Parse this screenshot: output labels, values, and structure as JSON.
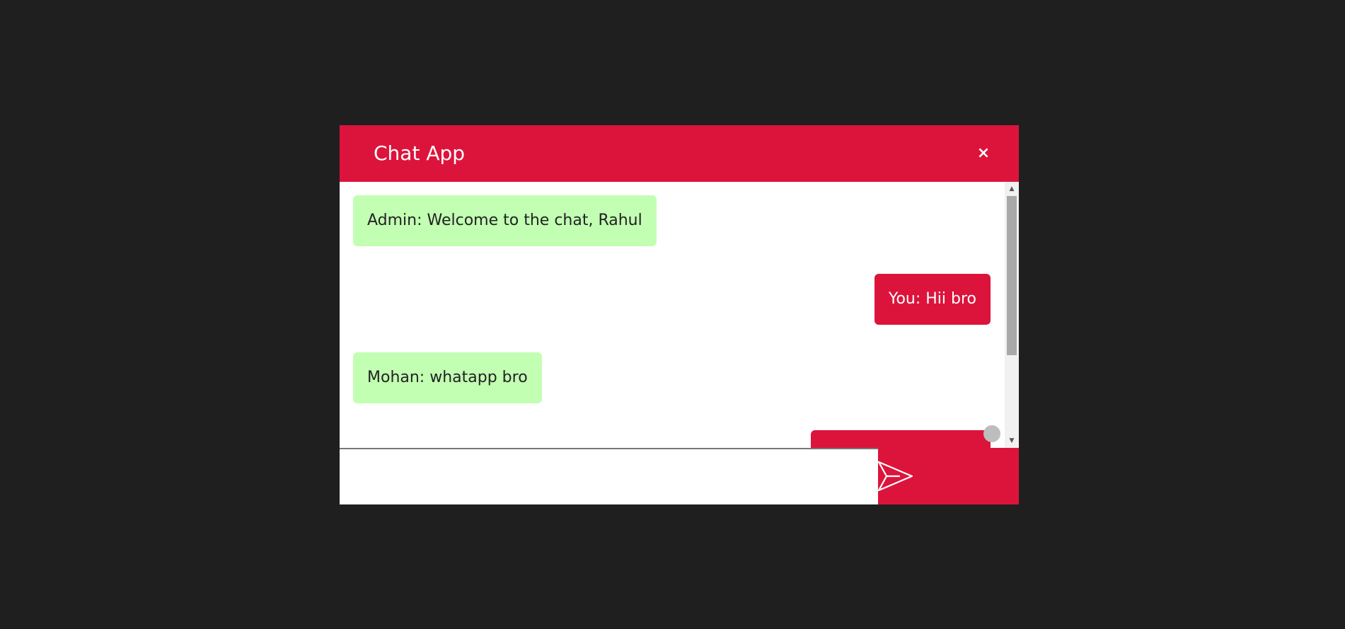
{
  "header": {
    "title": "Chat App",
    "close_label": "×"
  },
  "messages": [
    {
      "text": "Admin: Welcome to the chat, Rahul",
      "sender": "other"
    },
    {
      "text": "You: Hii bro",
      "sender": "self"
    },
    {
      "text": "Mohan: whatapp bro",
      "sender": "other"
    },
    {
      "text": "",
      "sender": "self"
    }
  ],
  "composer": {
    "input_value": "",
    "placeholder": "",
    "send_icon": "send-icon"
  },
  "colors": {
    "page_background": "#201f20",
    "accent": "#dc143c",
    "incoming_bubble": "#c2ffb3",
    "outgoing_bubble": "#dc143c"
  }
}
